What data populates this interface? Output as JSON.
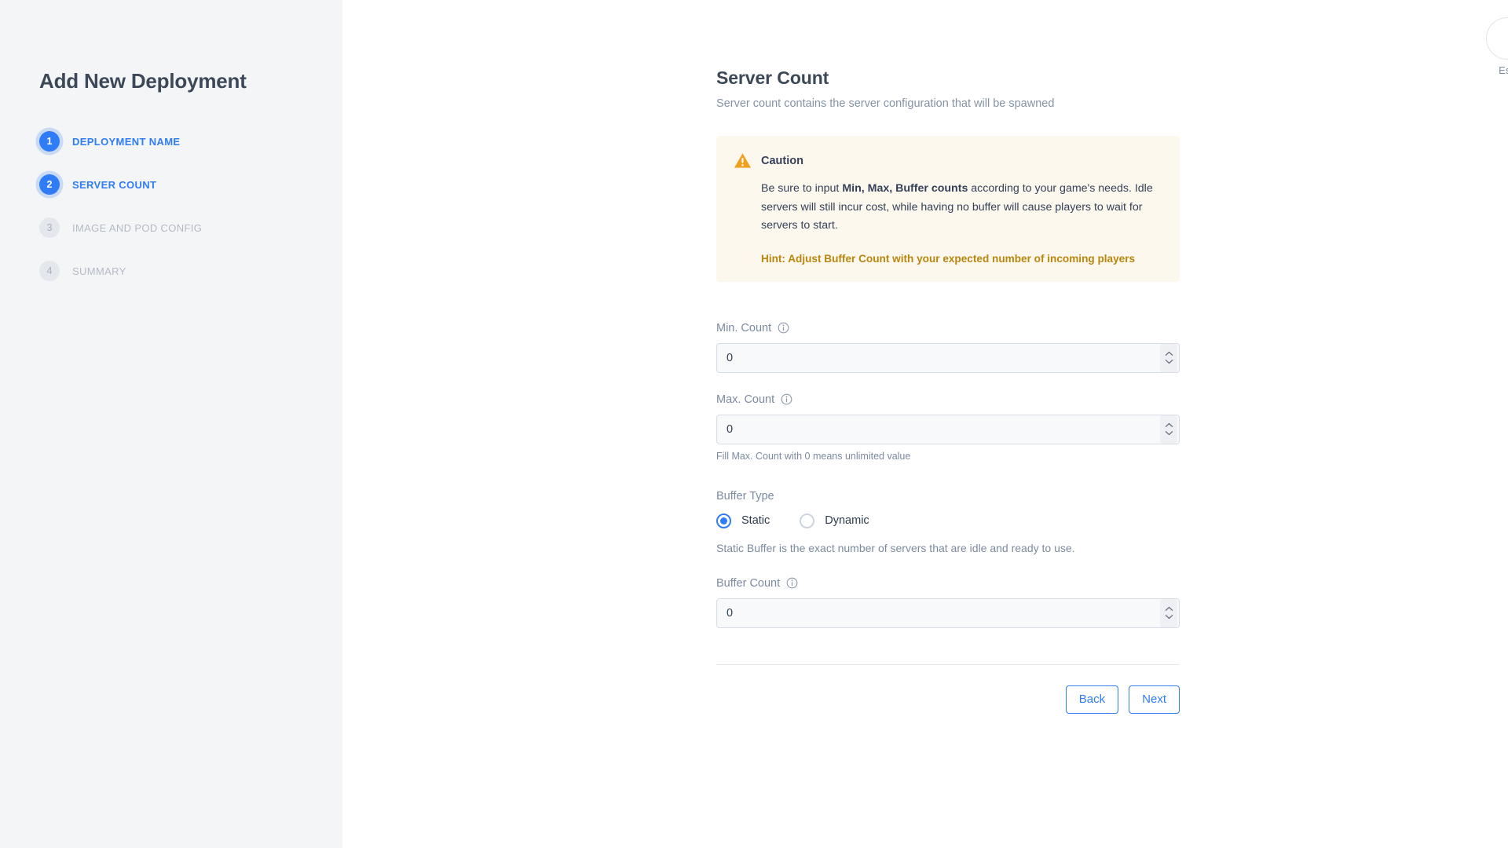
{
  "sidebar": {
    "title": "Add New Deployment",
    "steps": [
      {
        "number": "1",
        "label": "DEPLOYMENT NAME",
        "state": "active"
      },
      {
        "number": "2",
        "label": "SERVER COUNT",
        "state": "active"
      },
      {
        "number": "3",
        "label": "IMAGE AND POD CONFIG",
        "state": "inactive"
      },
      {
        "number": "4",
        "label": "SUMMARY",
        "state": "inactive"
      }
    ]
  },
  "page": {
    "title": "Server Count",
    "subtitle": "Server count contains the server configuration that will be spawned"
  },
  "caution": {
    "icon": "warning-triangle-icon",
    "title": "Caution",
    "body_pre": "Be sure to input ",
    "body_bold": "Min, Max, Buffer counts",
    "body_post": " according to your game's needs. Idle servers will still incur cost, while having no buffer will cause players to wait for servers to start.",
    "hint": "Hint: Adjust Buffer Count with your expected number of incoming players",
    "background": "#fdf8ed",
    "hint_color": "#b8860f",
    "icon_color": "#f0a020"
  },
  "fields": {
    "min_count": {
      "label": "Min. Count",
      "value": "0",
      "placeholder": "0",
      "info_icon": "info-circle-icon"
    },
    "max_count": {
      "label": "Max. Count",
      "value": "0",
      "placeholder": "0",
      "info_icon": "info-circle-icon",
      "helper": "Fill Max. Count with 0 means unlimited value"
    },
    "buffer_count": {
      "label": "Buffer Count",
      "value": "0",
      "placeholder": "0",
      "info_icon": "info-circle-icon"
    }
  },
  "buffer_type": {
    "label": "Buffer Type",
    "options": [
      {
        "label": "Static",
        "selected": true
      },
      {
        "label": "Dynamic",
        "selected": false
      }
    ],
    "description": "Static Buffer is the exact number of servers that are idle and ready to use."
  },
  "footer": {
    "back_label": "Back",
    "next_label": "Next"
  },
  "close": {
    "icon": "close-x-icon",
    "esc_label": "Esc"
  },
  "colors": {
    "accent": "#2f7cf6",
    "sidebar_bg": "#f4f5f7",
    "muted_text": "#7c8aa0",
    "heading": "#3c4858"
  }
}
